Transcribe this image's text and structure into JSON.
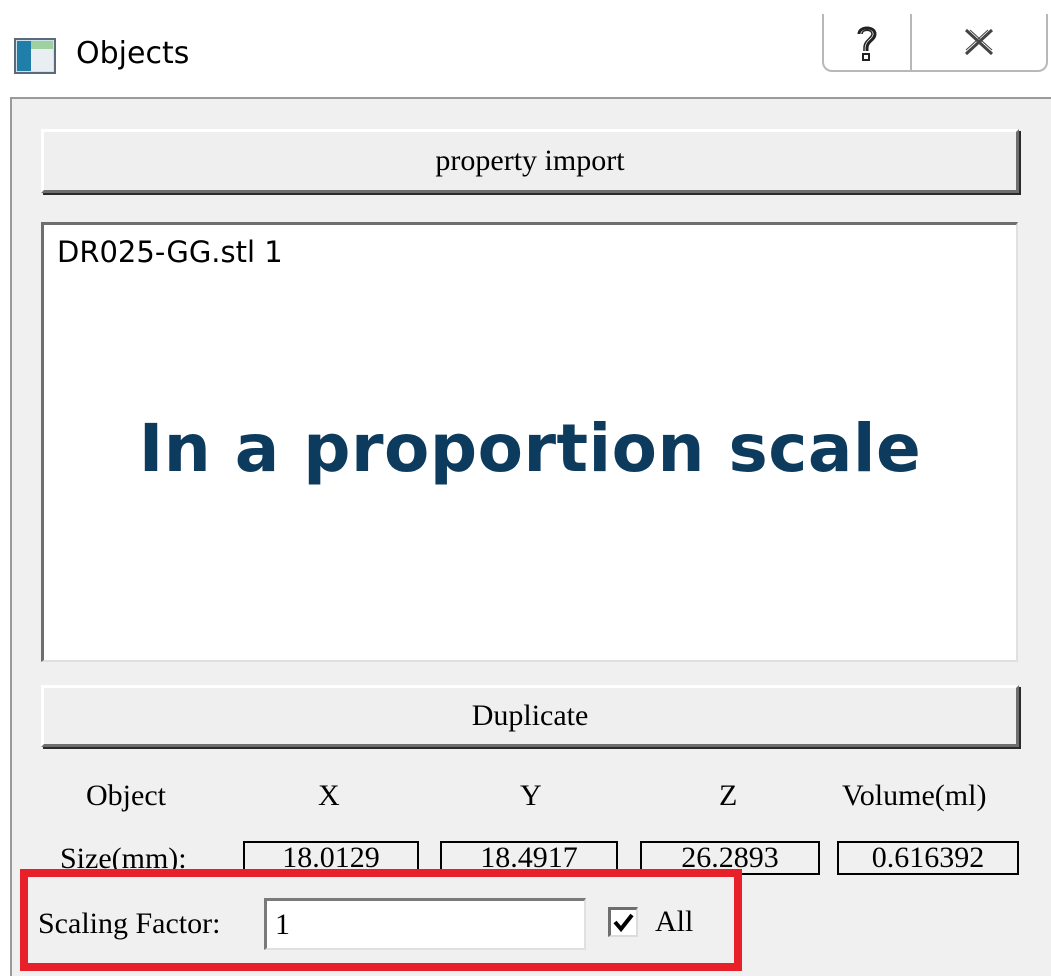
{
  "window": {
    "title": "Objects",
    "icon": "app-window-icon",
    "caption_buttons": [
      "help-icon",
      "close-icon"
    ]
  },
  "toolbar": {
    "property_import_label": "property import",
    "duplicate_label": "Duplicate"
  },
  "object_list": {
    "items": [
      "DR025-GG.stl 1"
    ]
  },
  "overlay": {
    "caption": "In a proportion scale",
    "color": "#0d3b5e"
  },
  "dimensions": {
    "headers": {
      "object": "Object",
      "x": "X",
      "y": "Y",
      "z": "Z",
      "volume": "Volume(ml)"
    },
    "size_label": "Size(mm):",
    "x_value": "18.0129",
    "y_value": "18.4917",
    "z_value": "26.2893",
    "volume_value": "0.616392"
  },
  "scaling": {
    "label": "Scaling Factor:",
    "value": "1",
    "all_label": "All",
    "all_checked": true
  },
  "highlight": {
    "color": "#e8202a"
  }
}
